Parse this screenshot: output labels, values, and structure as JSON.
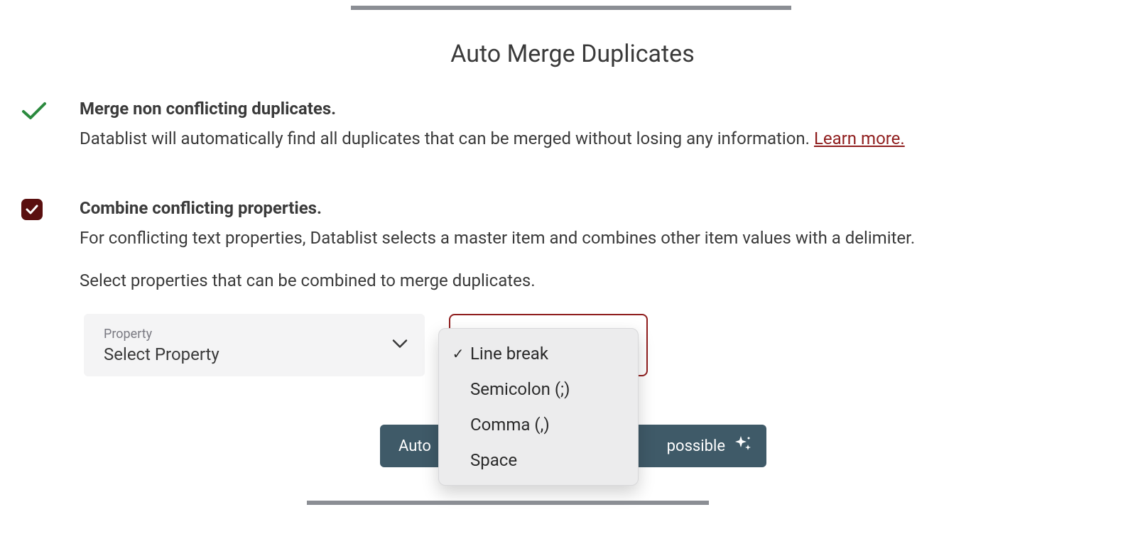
{
  "title": "Auto Merge Duplicates",
  "section1": {
    "heading": "Merge non conflicting duplicates.",
    "desc": "Datablist will automatically find all duplicates that can be merged without losing any information. ",
    "learn_more": "Learn more."
  },
  "section2": {
    "heading": "Combine conflicting properties.",
    "desc": "For conflicting text properties, Datablist selects a master item and combines other item values with a delimiter.",
    "hint": "Select properties that can be combined to merge duplicates.",
    "property_label": "Property",
    "property_value": "Select Property"
  },
  "auto_merge_button": {
    "left_text": "Auto",
    "right_text": "possible"
  },
  "dropdown": {
    "options": [
      {
        "label": "Line break",
        "checked": true
      },
      {
        "label": "Semicolon (;)",
        "checked": false
      },
      {
        "label": "Comma (,)",
        "checked": false
      },
      {
        "label": "Space",
        "checked": false
      }
    ]
  },
  "colors": {
    "accent_red": "#8f1d1d",
    "checkbox_bg": "#5a0f0f",
    "button_bg": "#3f5a68",
    "check_green": "#2b8a3e"
  }
}
